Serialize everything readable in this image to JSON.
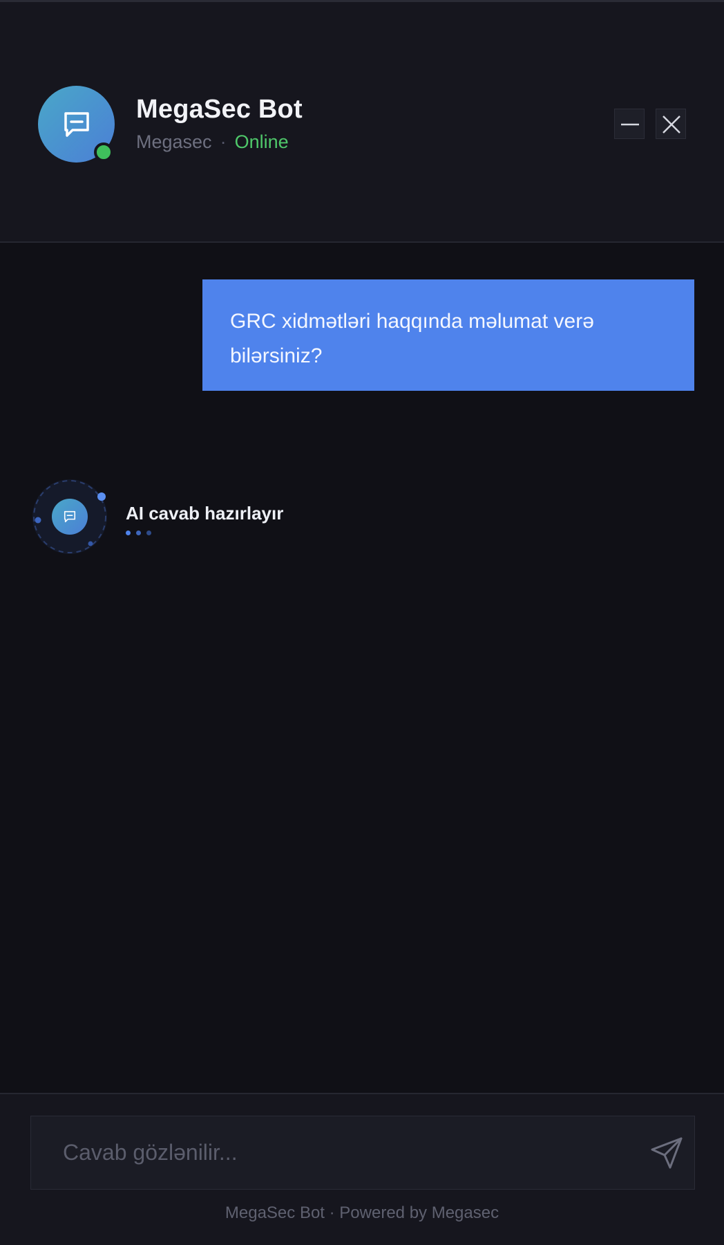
{
  "header": {
    "bot_name": "MegaSec Bot",
    "company": "Megasec",
    "separator": "·",
    "status": "Online",
    "status_color": "#4fc86a",
    "avatar_icon": "chat-bubble-icon",
    "minimize_icon": "minimize-icon",
    "close_icon": "close-icon"
  },
  "messages": [
    {
      "role": "user",
      "text": "GRC xidmətləri haqqında məlumat verə bilərsiniz?"
    }
  ],
  "typing": {
    "label": "AI cavab hazırlayır",
    "icon": "chat-bubble-icon"
  },
  "composer": {
    "placeholder": "Cavab gözlənilir...",
    "value": "",
    "send_icon": "send-icon"
  },
  "footer": {
    "text": "MegaSec Bot · Powered by Megasec"
  },
  "colors": {
    "accent": "#4f83ec",
    "background": "#101016",
    "header_background": "#16161e",
    "online": "#3fbf5c"
  }
}
